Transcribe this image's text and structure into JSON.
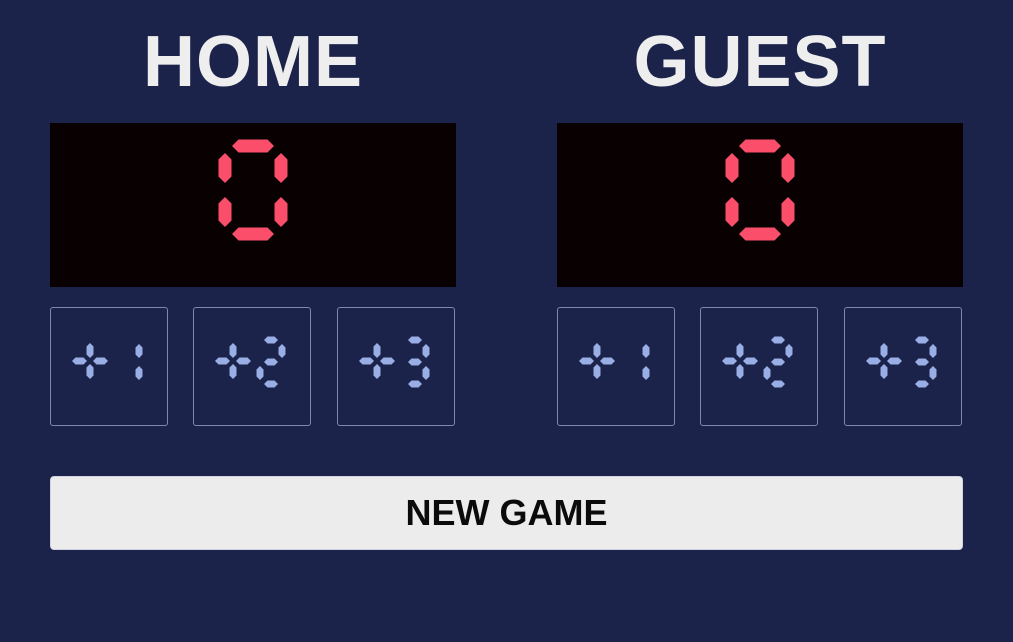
{
  "home": {
    "title": "HOME",
    "score": "0",
    "buttons": [
      {
        "label": "+1"
      },
      {
        "label": "+2"
      },
      {
        "label": "+3"
      }
    ]
  },
  "guest": {
    "title": "GUEST",
    "score": "0",
    "buttons": [
      {
        "label": "+1"
      },
      {
        "label": "+2"
      },
      {
        "label": "+3"
      }
    ]
  },
  "new_game_label": "NEW GAME",
  "colors": {
    "background": "#1b234a",
    "score_digit": "#fb4e6b",
    "score_box": "#080001",
    "button_glyph": "#9aaee6",
    "button_border": "#7d87b4",
    "title_text": "#eeeeee",
    "new_game_bg": "#ececec"
  }
}
